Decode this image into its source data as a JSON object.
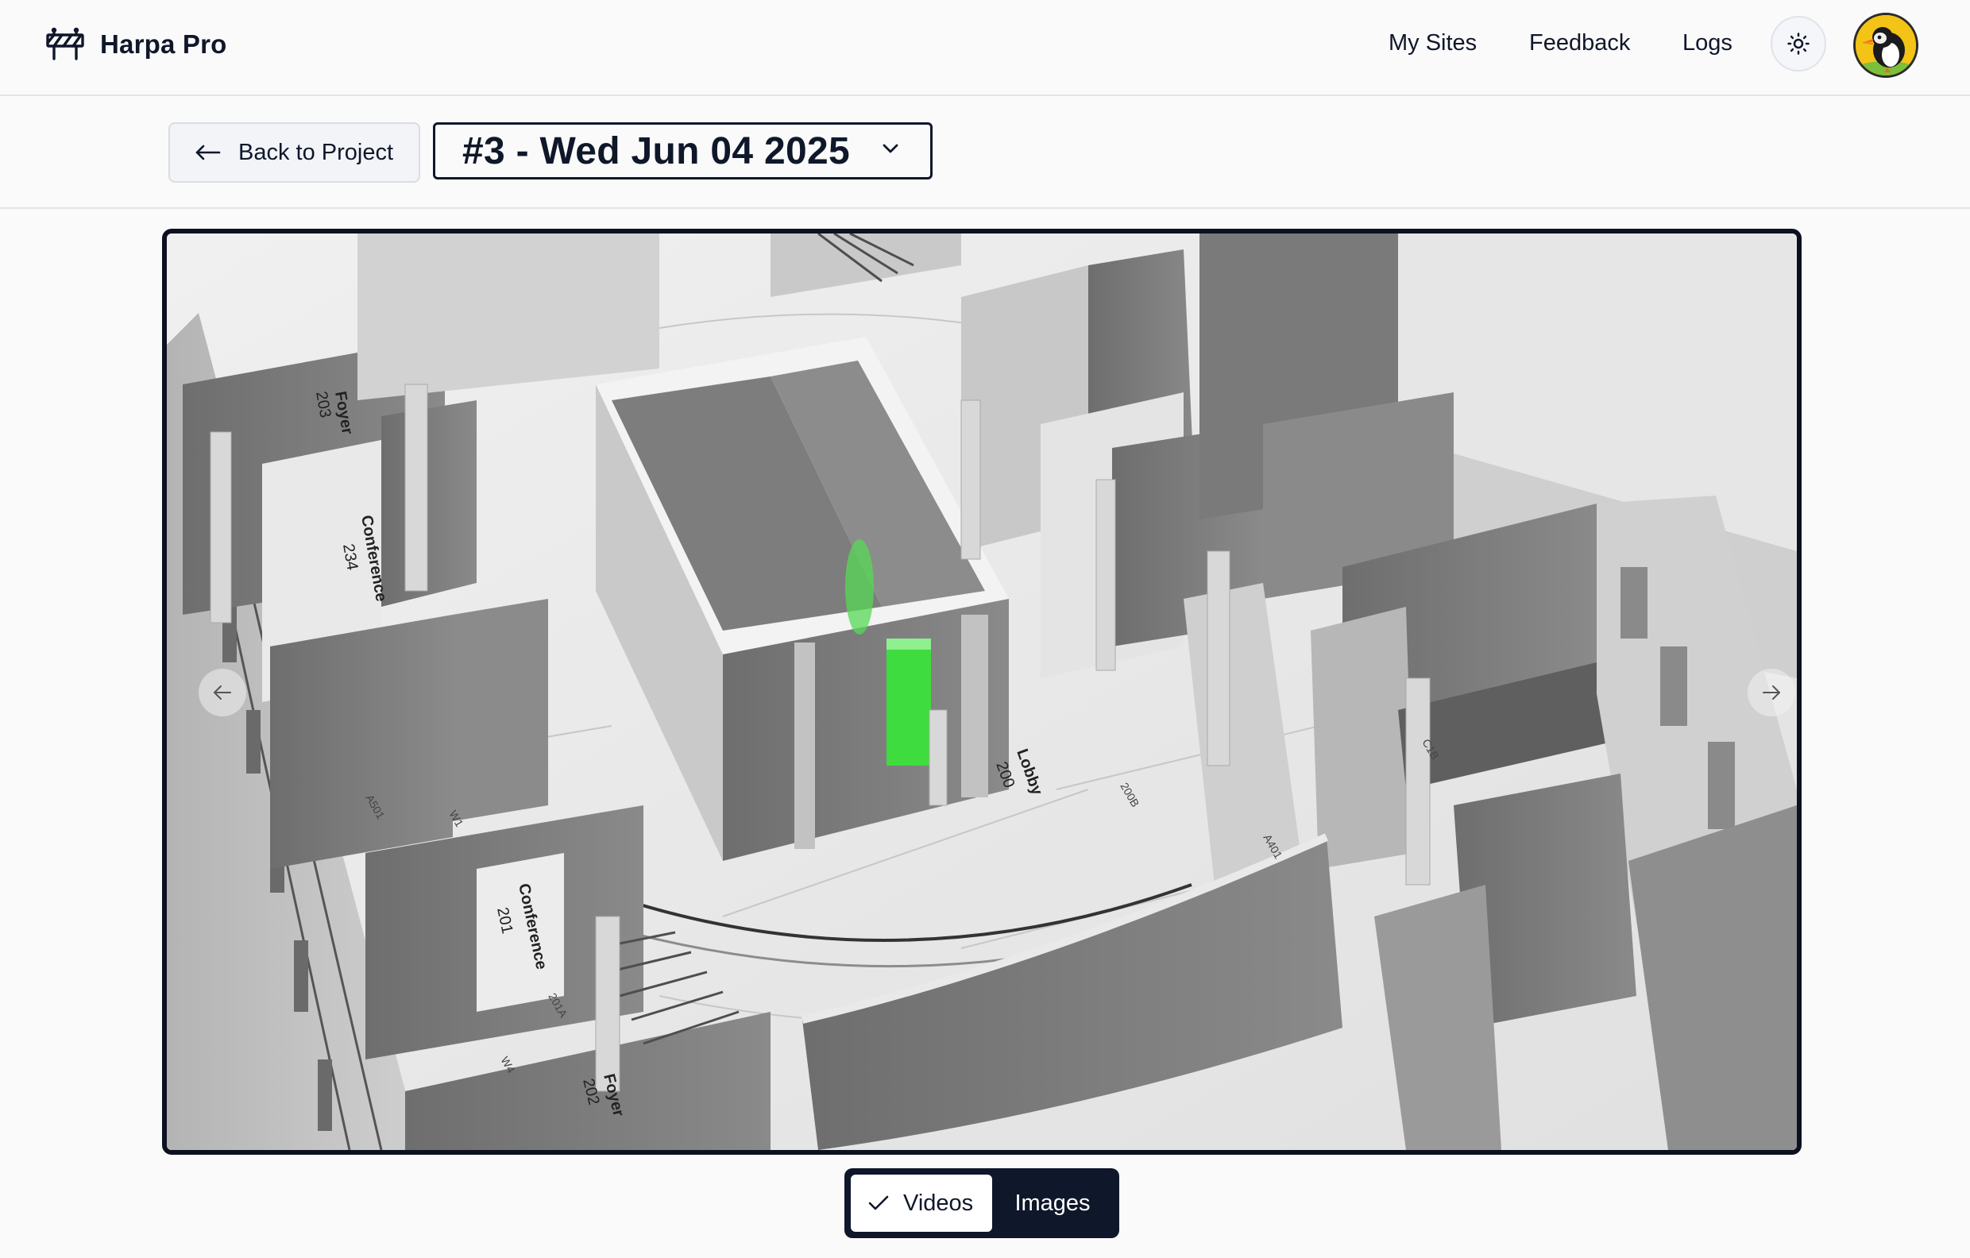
{
  "app": {
    "name": "Harpa Pro",
    "logo_icon": "road-barrier-icon"
  },
  "nav": {
    "my_sites": "My Sites",
    "feedback": "Feedback",
    "logs": "Logs",
    "theme_icon": "sun-icon",
    "avatar_icon": "puffin-avatar"
  },
  "toolbar": {
    "back_label": "Back to Project",
    "back_icon": "arrow-left-icon",
    "capture_select": {
      "value": "#3 - Wed Jun 04 2025",
      "icon": "chevron-down-icon"
    }
  },
  "viewer": {
    "prev_icon": "arrow-left-icon",
    "next_icon": "arrow-right-icon",
    "room_labels": [
      {
        "name": "Foyer",
        "number": "203"
      },
      {
        "name": "Conference",
        "number": "234"
      },
      {
        "name": "Lobby",
        "number": "200"
      },
      {
        "name": "Conference",
        "number": "201"
      },
      {
        "name": "Foyer",
        "number": "202"
      }
    ],
    "tags": [
      "W1",
      "W4",
      "C1B",
      "201A",
      "200B",
      "A401",
      "A501"
    ],
    "highlight_color": "#3fdc3f"
  },
  "media_toggle": {
    "videos": "Videos",
    "images": "Images",
    "selected": "Videos",
    "check_icon": "check-icon"
  }
}
